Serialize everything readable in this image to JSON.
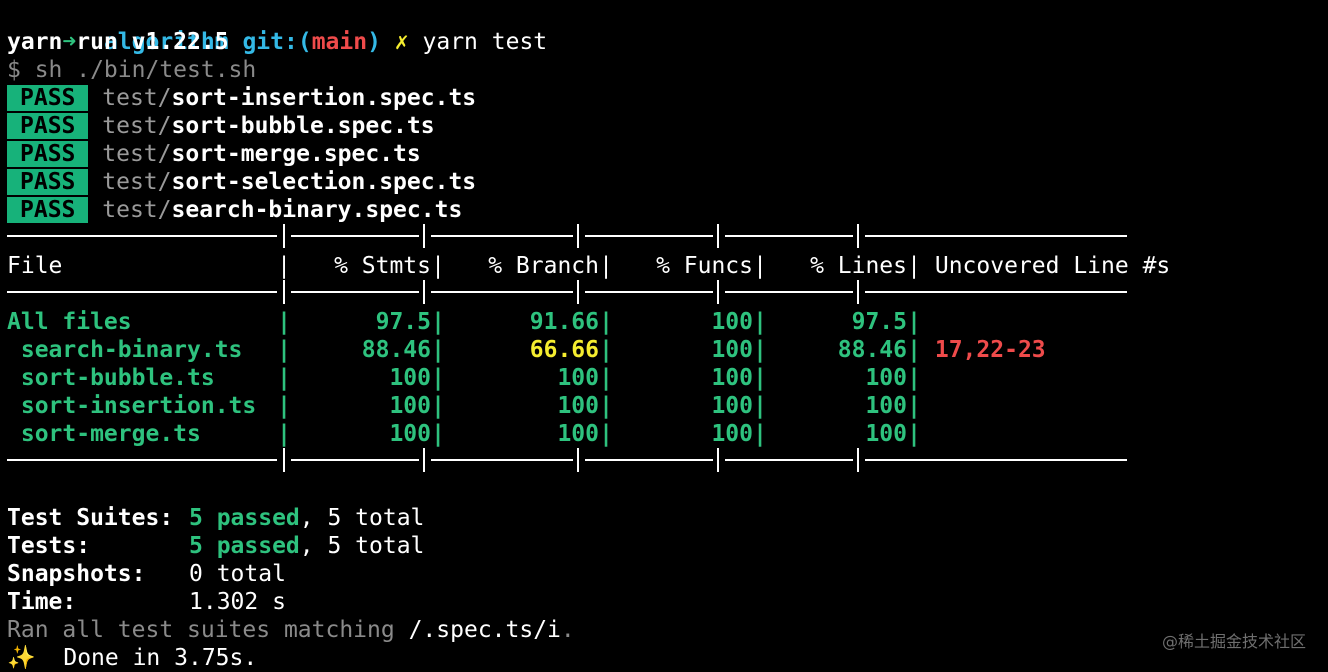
{
  "prompt": {
    "arrow": "➜",
    "dir": "algorithm",
    "git_label": "git:(",
    "branch": "main",
    "git_close": ")",
    "dirty_mark": "✗",
    "command": "yarn test"
  },
  "yarn_header": "yarn run v1.22.5",
  "script_line": "$ sh ./bin/test.sh",
  "pass_label": "PASS",
  "test_dir": "test/",
  "test_files": [
    "sort-insertion.spec.ts",
    "sort-bubble.spec.ts",
    "sort-merge.spec.ts",
    "sort-selection.spec.ts",
    "search-binary.spec.ts"
  ],
  "coverage": {
    "headers": [
      "File",
      "% Stmts",
      "% Branch",
      "% Funcs",
      "% Lines",
      "Uncovered Line #s"
    ],
    "rows": [
      {
        "file": "All files",
        "stmts": "97.5",
        "branch": "91.66",
        "funcs": "100",
        "lines": "97.5",
        "uncovered": ""
      },
      {
        "file": " search-binary.ts",
        "stmts": "88.46",
        "branch": "66.66",
        "funcs": "100",
        "lines": "88.46",
        "uncovered": "17,22-23"
      },
      {
        "file": " sort-bubble.ts",
        "stmts": "100",
        "branch": "100",
        "funcs": "100",
        "lines": "100",
        "uncovered": ""
      },
      {
        "file": " sort-insertion.ts",
        "stmts": "100",
        "branch": "100",
        "funcs": "100",
        "lines": "100",
        "uncovered": ""
      },
      {
        "file": " sort-merge.ts",
        "stmts": "100",
        "branch": "100",
        "funcs": "100",
        "lines": "100",
        "uncovered": ""
      }
    ]
  },
  "summary": {
    "suites_label": "Test Suites:",
    "suites_passed": "5 passed",
    "suites_total": ", 5 total",
    "tests_label": "Tests:",
    "tests_passed": "5 passed",
    "tests_total": ", 5 total",
    "snapshots_label": "Snapshots:",
    "snapshots_value": "0 total",
    "time_label": "Time:",
    "time_value": "1.302 s",
    "ran_prefix": "Ran all test suites matching ",
    "ran_pattern": "/.spec.ts/i",
    "ran_suffix": ".",
    "sparkle": "✨",
    "done": "Done in 3.75s."
  },
  "watermark": "@稀土掘金技术社区",
  "colors": {
    "background": "#000000",
    "cyan": "#34b9e6",
    "red": "#ef4b4b",
    "green": "#2ec27e",
    "yellow": "#f5ed2f",
    "pass_badge": "#17b27a",
    "dim": "#8a8a8a"
  }
}
